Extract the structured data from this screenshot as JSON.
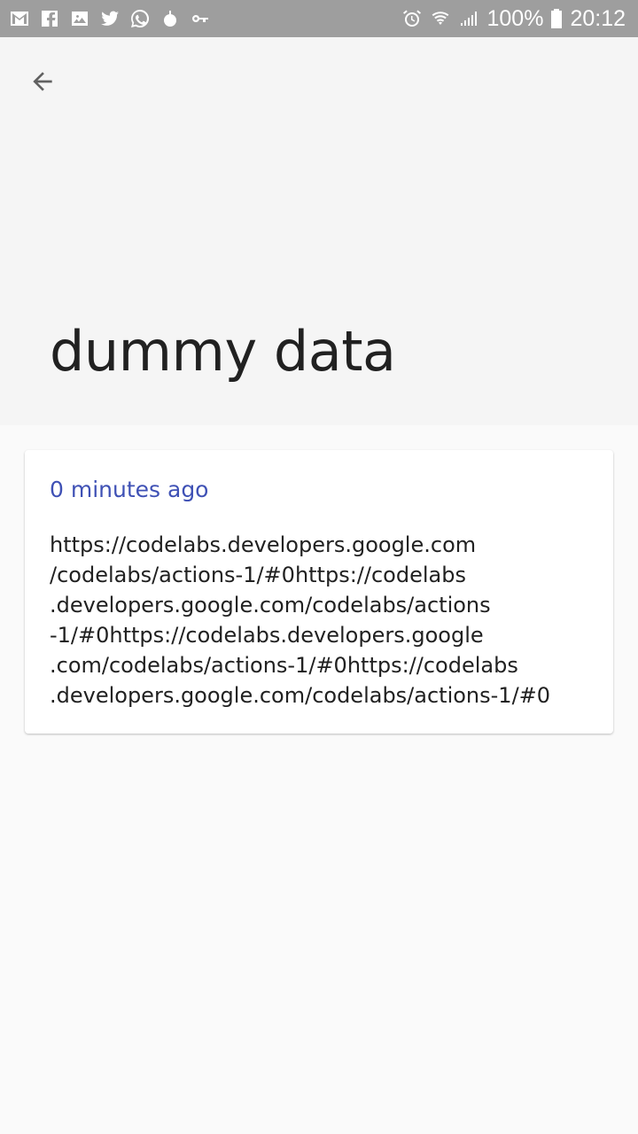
{
  "status_bar": {
    "left_icons": [
      "gmail-icon",
      "facebook-icon",
      "gallery-icon",
      "twitter-icon",
      "whatsapp-icon",
      "bomb-icon",
      "key-icon"
    ],
    "right_icons": [
      "alarm-icon",
      "wifi-icon",
      "signal-icon",
      "battery-icon"
    ],
    "battery_text": "100%",
    "time": "20:12"
  },
  "header": {
    "back_icon": "arrow-back-icon",
    "title": "dummy data"
  },
  "card": {
    "timestamp": "0 minutes ago",
    "content": "https://codelabs.developers.google.com\n/codelabs/actions-1/#0https://codelabs\n.developers.google.com/codelabs/actions\n-1/#0https://codelabs.developers.google\n.com/codelabs/actions-1/#0https://codelabs\n.developers.google.com/codelabs/actions-1/#0"
  },
  "colors": {
    "status_bar": "#9e9e9e",
    "header_bg": "#f5f5f5",
    "page_bg": "#fafafa",
    "accent": "#3f51b5",
    "text": "#212121"
  }
}
